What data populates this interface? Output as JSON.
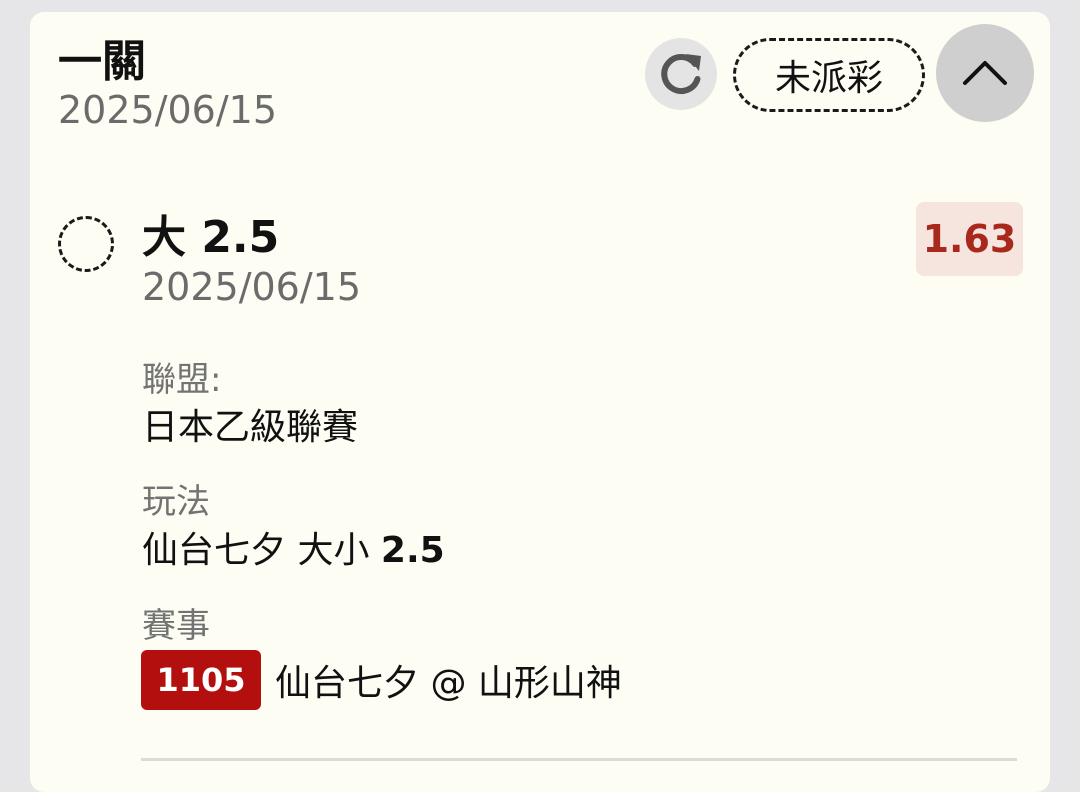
{
  "bet": {
    "title": "一關",
    "date": "2025/06/15",
    "status": "未派彩",
    "icons": {
      "refresh": "refresh-icon",
      "collapse": "chevron-up-icon",
      "select": "dashed-circle-icon"
    }
  },
  "selection": {
    "title": "大 2.5",
    "date": "2025/06/15",
    "odds": "1.63"
  },
  "details": {
    "league_label": "聯盟:",
    "league_value": "日本乙級聯賽",
    "market_label": "玩法",
    "market_value_prefix": "仙台七夕 大小 ",
    "market_value_line": "2.5",
    "match_label": "賽事",
    "match_id": "1105",
    "match_name": "仙台七夕 @ 山形山神"
  },
  "colors": {
    "card_bg": "#fefdf4",
    "page_bg": "#e6e6e8",
    "odds_text": "#a8281c",
    "odds_bg": "#f6e4de",
    "match_id_bg": "#b40f0f"
  }
}
